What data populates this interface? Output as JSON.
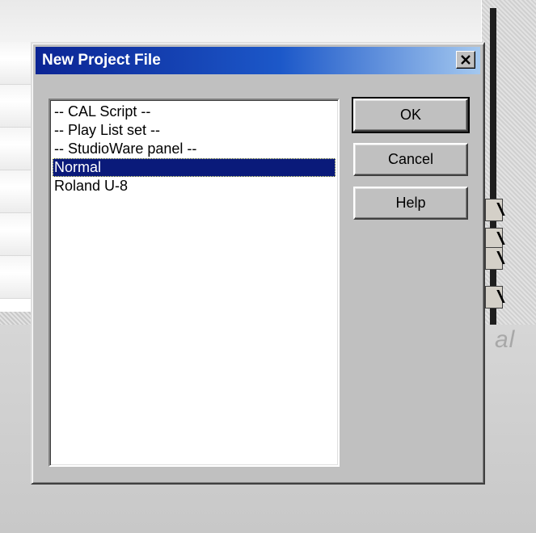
{
  "dialog": {
    "title": "New Project File",
    "close_label": "×"
  },
  "templates": {
    "items": [
      {
        "label": "-- CAL Script --",
        "selected": false
      },
      {
        "label": "-- Play List set --",
        "selected": false
      },
      {
        "label": "-- StudioWare panel --",
        "selected": false
      },
      {
        "label": "Normal",
        "selected": true
      },
      {
        "label": "Roland U-8",
        "selected": false
      }
    ]
  },
  "buttons": {
    "ok": "OK",
    "cancel": "Cancel",
    "help": "Help"
  },
  "background": {
    "partial_text": "al"
  },
  "colors": {
    "title_gradient_start": "#0b2494",
    "title_gradient_end": "#a4c8ef",
    "selection": "#0a1a7a",
    "dialog_face": "#c0c0c0"
  }
}
